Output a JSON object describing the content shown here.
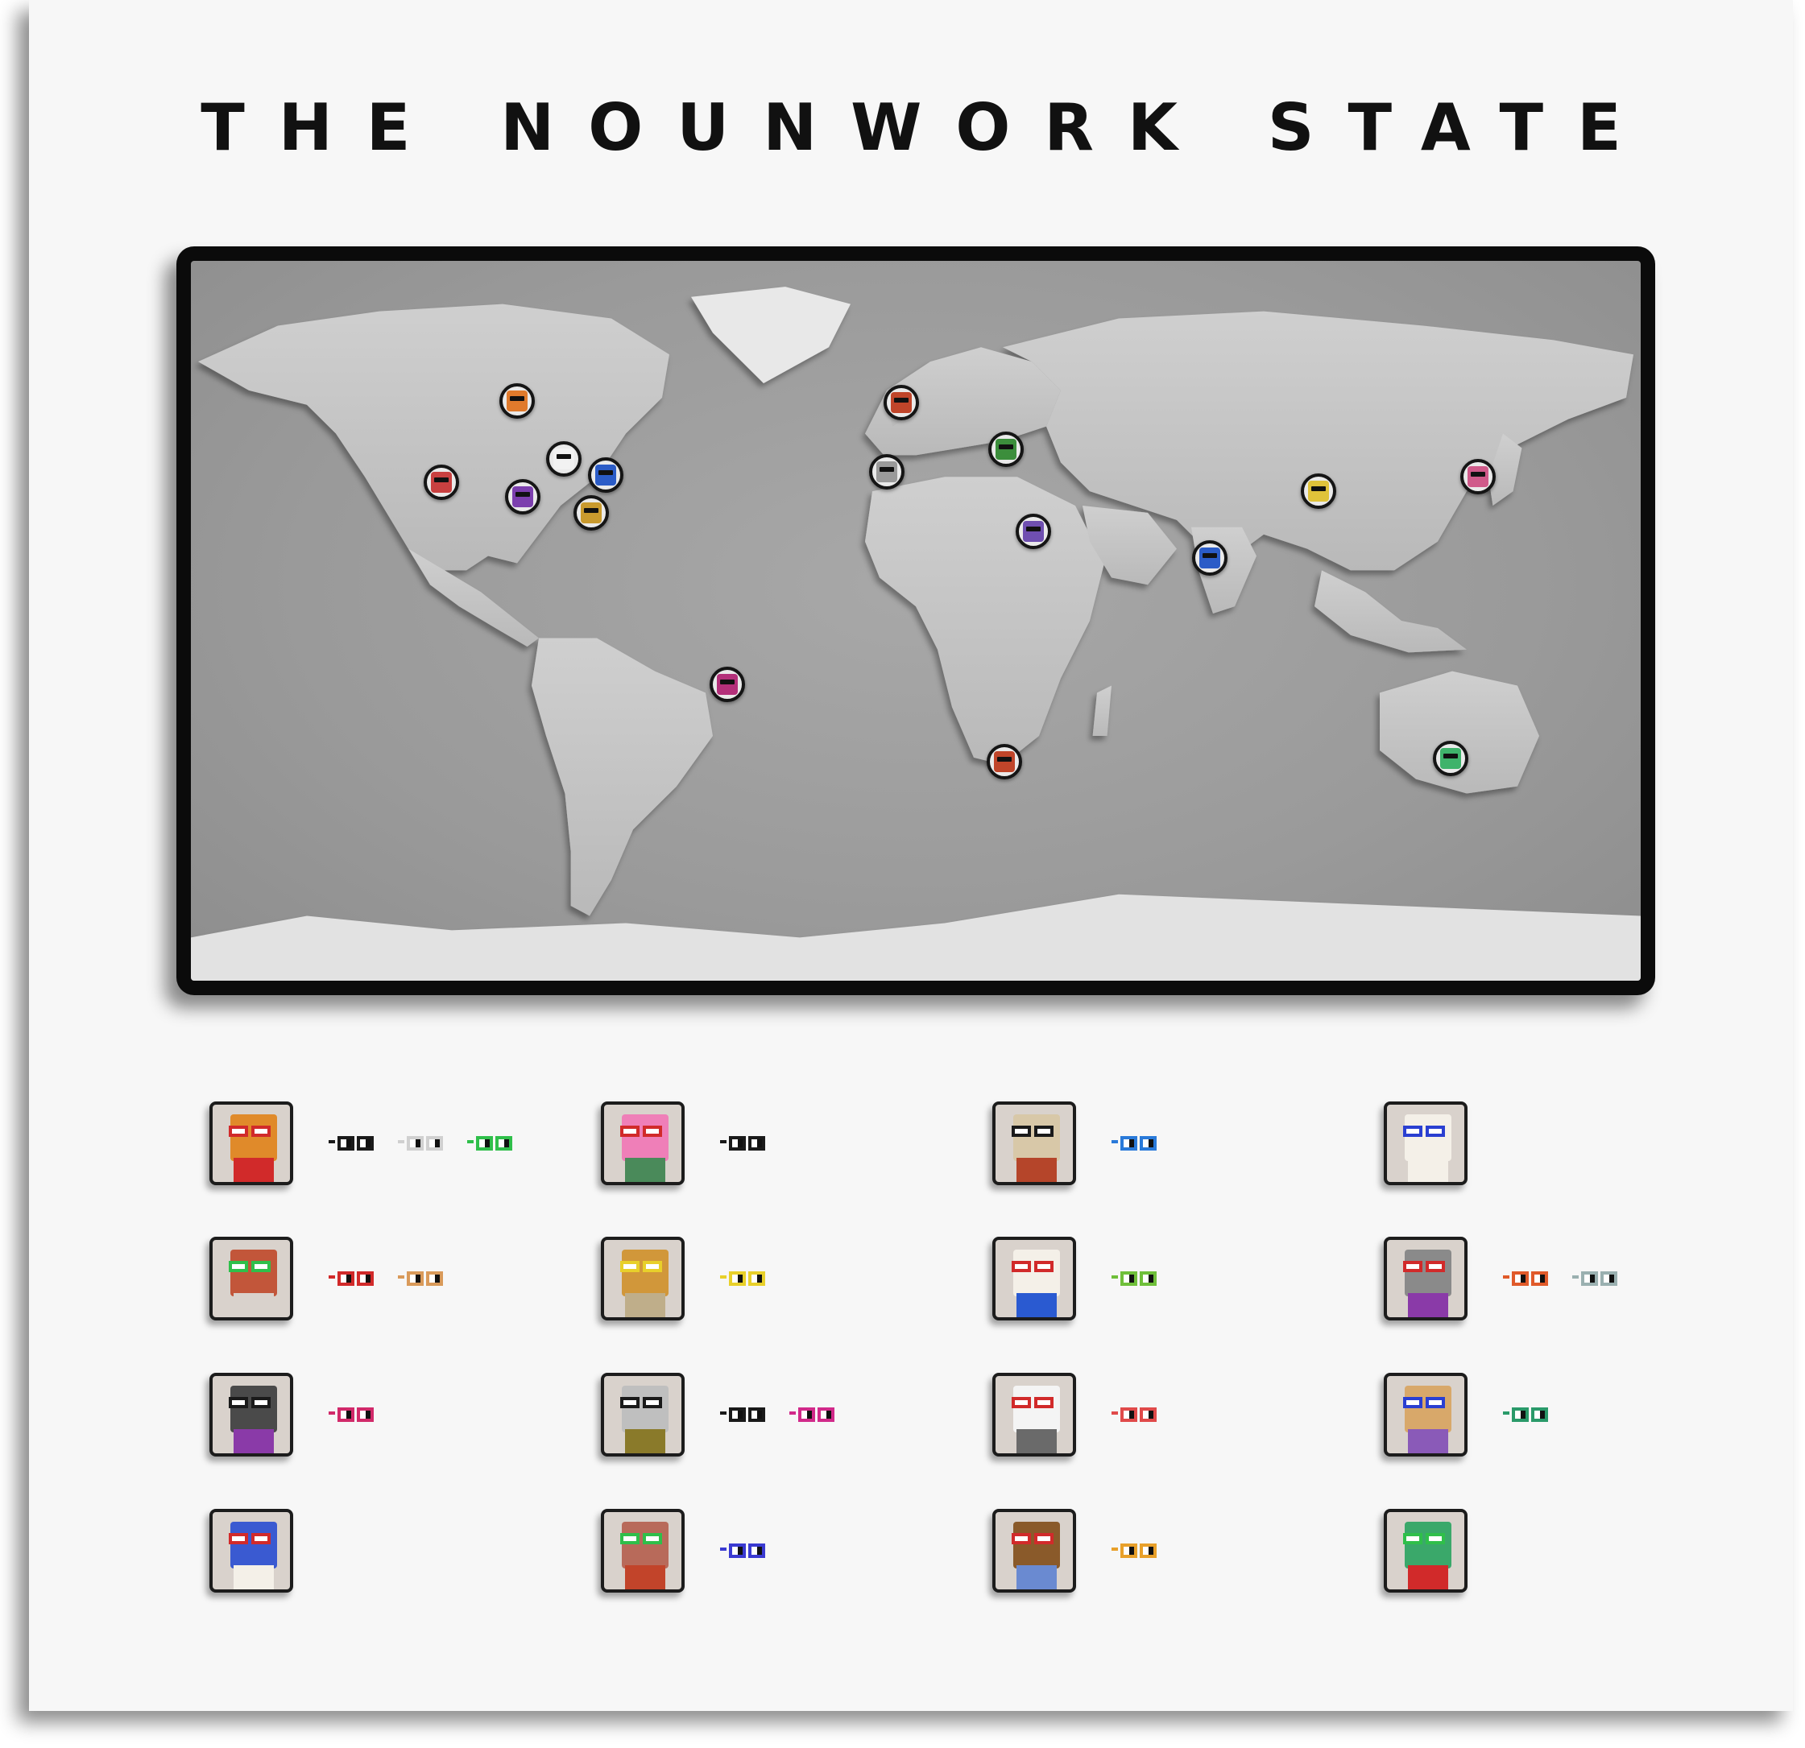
{
  "title": "THE NOUNWORK STATE",
  "map": {
    "pins": [
      {
        "name": "pin-canada-west",
        "color": "#e07a2c"
      },
      {
        "name": "pin-california",
        "color": "#c94040"
      },
      {
        "name": "pin-great-lakes",
        "color": "#f2f2f2"
      },
      {
        "name": "pin-new-york",
        "color": "#2b5cc7"
      },
      {
        "name": "pin-texas",
        "color": "#7c3fae"
      },
      {
        "name": "pin-florida",
        "color": "#c99a2e"
      },
      {
        "name": "pin-brazil",
        "color": "#b4307a"
      },
      {
        "name": "pin-uk",
        "color": "#c0452a"
      },
      {
        "name": "pin-spain",
        "color": "#9a9a9a"
      },
      {
        "name": "pin-italy",
        "color": "#3c8e3c"
      },
      {
        "name": "pin-egypt",
        "color": "#6f4fb0"
      },
      {
        "name": "pin-india",
        "color": "#2b5cc7"
      },
      {
        "name": "pin-china",
        "color": "#e0c33a"
      },
      {
        "name": "pin-japan",
        "color": "#d05a8a"
      },
      {
        "name": "pin-south-africa",
        "color": "#c0452a"
      },
      {
        "name": "pin-australia",
        "color": "#3fb36b"
      }
    ]
  },
  "members": [
    {
      "name": "noun-lol-cat",
      "bg": "#d9d2cc",
      "head": "#e08a2a",
      "body": "#d12a2a",
      "glasses": "#d12a2a",
      "badges": [
        "#1a1a1a",
        "#d0d0d0",
        "#2fbf4a"
      ]
    },
    {
      "name": "noun-pink-squid",
      "bg": "#d9d2cc",
      "head": "#ef7fb8",
      "body": "#4a8a5a",
      "glasses": "#d12a2a",
      "badges": [
        "#1a1a1a"
      ]
    },
    {
      "name": "noun-newspaper",
      "bg": "#d9d2cc",
      "head": "#d8c8a8",
      "body": "#b5452a",
      "glasses": "#1a1a1a",
      "badges": [
        "#2a7ad9"
      ]
    },
    {
      "name": "noun-duck",
      "bg": "#d9d2cc",
      "head": "#f4f0e8",
      "body": "#f4f0e8",
      "glasses": "#2a3fd1",
      "badges": []
    },
    {
      "name": "noun-brick-wall",
      "bg": "#d9d2cc",
      "head": "#c2563a",
      "body": "#d9d2cc",
      "glasses": "#2fbf4a",
      "badges": [
        "#d12a2a",
        "#d99a5a"
      ]
    },
    {
      "name": "noun-burger",
      "bg": "#d9d2cc",
      "head": "#d1973a",
      "body": "#bfae8a",
      "glasses": "#e8d02a",
      "badges": [
        "#e8d02a"
      ]
    },
    {
      "name": "noun-chicken",
      "bg": "#d9d2cc",
      "head": "#f4f0e8",
      "body": "#2a5ad1",
      "glasses": "#d12a2a",
      "badges": [
        "#6fbf3a"
      ]
    },
    {
      "name": "noun-dispenser",
      "bg": "#d9d2cc",
      "head": "#8a8a8a",
      "body": "#8a3aa8",
      "glasses": "#d12a2a",
      "badges": [
        "#e05a2a",
        "#9ab0b0"
      ]
    },
    {
      "name": "noun-helmet",
      "bg": "#d9d2cc",
      "head": "#4a4a4a",
      "body": "#8a3aa8",
      "glasses": "#1a1a1a",
      "badges": [
        "#d12a6a"
      ]
    },
    {
      "name": "noun-bunny-robot",
      "bg": "#d9d2cc",
      "head": "#bfbfbf",
      "body": "#8a7a2a",
      "glasses": "#1a1a1a",
      "badges": [
        "#1a1a1a",
        "#d12a8a"
      ]
    },
    {
      "name": "noun-panda",
      "bg": "#d9d2cc",
      "head": "#f4f4f4",
      "body": "#6a6a6a",
      "glasses": "#d12a2a",
      "badges": [
        "#e04a4a"
      ]
    },
    {
      "name": "noun-pirate",
      "bg": "#d9d2cc",
      "head": "#d8a86a",
      "body": "#8a5ab8",
      "glasses": "#2a3fd1",
      "badges": [
        "#2a9a6a"
      ]
    },
    {
      "name": "noun-wizard",
      "bg": "#d9d2cc",
      "head": "#3a5ad1",
      "body": "#f4f0e8",
      "glasses": "#d12a2a",
      "badges": []
    },
    {
      "name": "noun-rabbit",
      "bg": "#d9d2cc",
      "head": "#b86a5a",
      "body": "#c2442a",
      "glasses": "#2fbf4a",
      "badges": [
        "#3a3ad1"
      ]
    },
    {
      "name": "noun-ship",
      "bg": "#d9d2cc",
      "head": "#8a5a2a",
      "body": "#6a8ad1",
      "glasses": "#d12a2a",
      "badges": [
        "#e8a02a"
      ]
    },
    {
      "name": "noun-frog",
      "bg": "#d9d2cc",
      "head": "#3aa86a",
      "body": "#d12a2a",
      "glasses": "#2fbf4a",
      "badges": []
    }
  ]
}
